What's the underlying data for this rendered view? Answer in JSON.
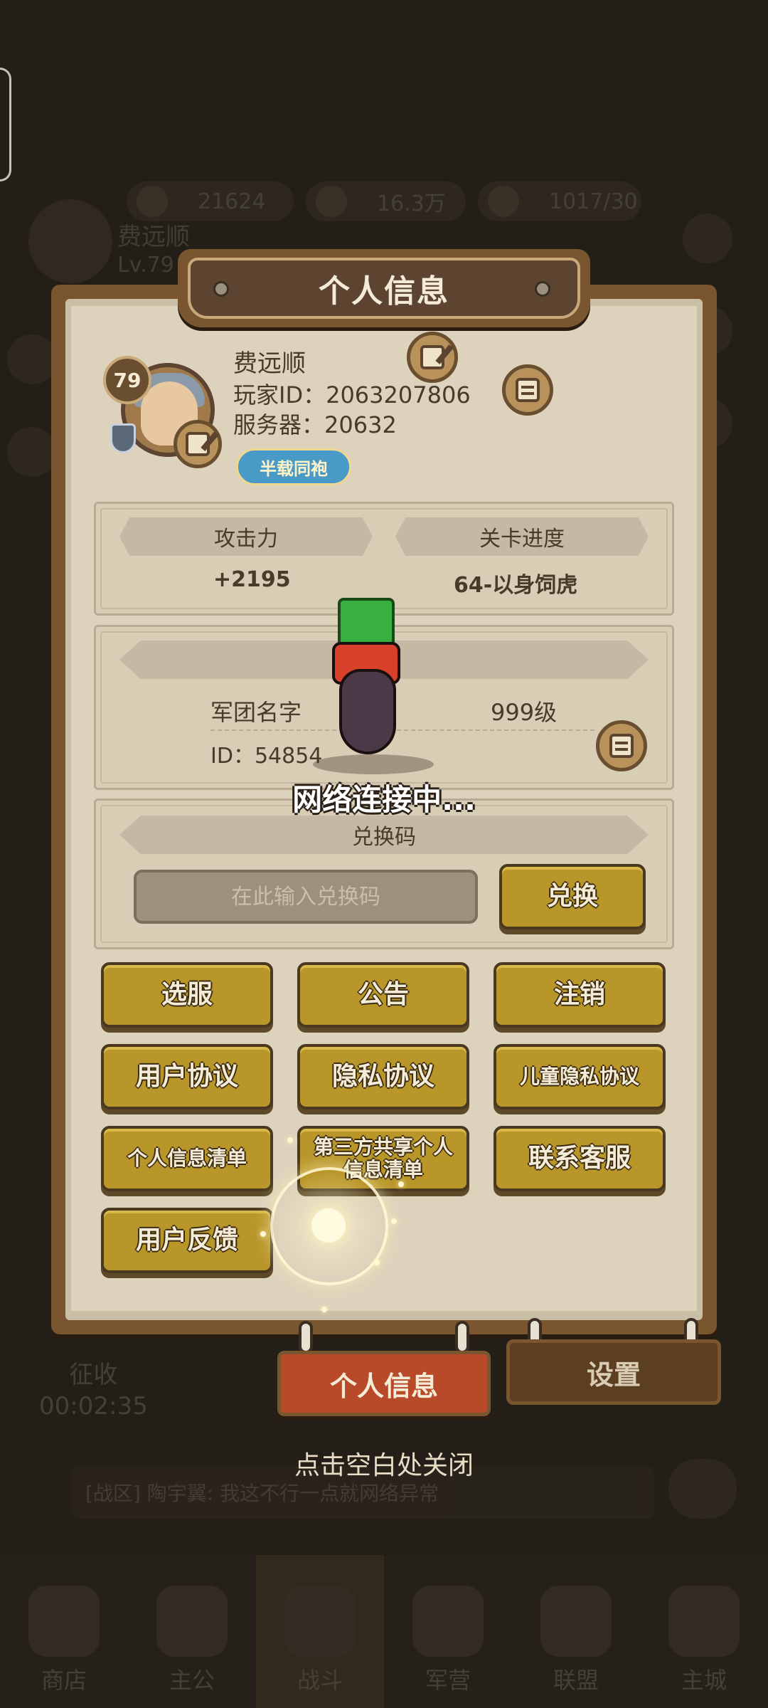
{
  "background": {
    "resources": [
      {
        "icon": "meat-icon",
        "value": "21624"
      },
      {
        "icon": "coin-icon",
        "value": "16.3万"
      },
      {
        "icon": "stamina-icon",
        "value": "1017/30"
      }
    ],
    "player_name": "费远顺",
    "player_level": "Lv.79",
    "collect_label": "征收",
    "collect_timer": "00:02:35",
    "chat_message": "[战区] 陶宇翼: 我这不行一点就网络异常",
    "nav": [
      "商店",
      "主公",
      "战斗",
      "军营",
      "联盟",
      "主城"
    ]
  },
  "panel": {
    "title": "个人信息",
    "profile": {
      "level": "79",
      "name": "费远顺",
      "player_id": "玩家ID：2063207806",
      "server": "服务器：20632",
      "badge": "半载同袍"
    },
    "stats": {
      "attack_label": "攻击力",
      "attack_value": "+2195",
      "progress_label": "关卡进度",
      "progress_value": "64-以身饲虎"
    },
    "legion": {
      "name": "军团名字",
      "level": "999级",
      "id": "ID：54854"
    },
    "redeem": {
      "label": "兑换码",
      "placeholder": "在此输入兑换码",
      "button": "兑换"
    },
    "buttons": {
      "select_server": "选服",
      "announcement": "公告",
      "logout": "注销",
      "user_agreement": "用户协议",
      "privacy_agreement": "隐私协议",
      "child_privacy": "儿童隐私协议",
      "personal_info_list": "个人信息清单",
      "third_party_share": "第三方共享个人信息清单",
      "contact_support": "联系客服",
      "feedback": "用户反馈"
    },
    "tabs": {
      "personal_info": "个人信息",
      "settings": "设置"
    }
  },
  "loading_text": "网络连接中...",
  "close_hint": "点击空白处关闭",
  "colors": {
    "panel_frame": "#7a5630",
    "paper": "#ddd3bd",
    "gold_button": "#b8962a",
    "active_tab": "#b84a2a"
  }
}
